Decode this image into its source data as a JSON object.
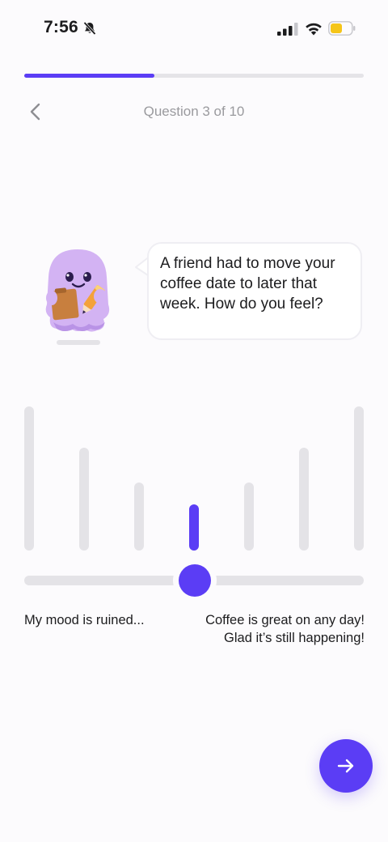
{
  "status_bar": {
    "time": "7:56",
    "icons": [
      "bell-slash-icon",
      "cellular-signal-icon",
      "wifi-icon",
      "battery-icon"
    ],
    "battery_color": "#f5c518"
  },
  "progress": {
    "fraction": 0.3833,
    "color": "#5b3df5"
  },
  "header": {
    "back_icon": "chevron-left-icon",
    "question_label": "Question 3 of 10"
  },
  "prompt": {
    "text": "A friend had to move your coffee date to later that week. How do you feel?"
  },
  "mood_scale": {
    "levels": 7,
    "selected_index": 3,
    "active_color": "#5b3df5",
    "min_label": "My mood is ruined...",
    "max_label": "Coffee is great on any day! Glad it’s still happening!"
  },
  "next_button": {
    "icon": "arrow-right-icon"
  }
}
